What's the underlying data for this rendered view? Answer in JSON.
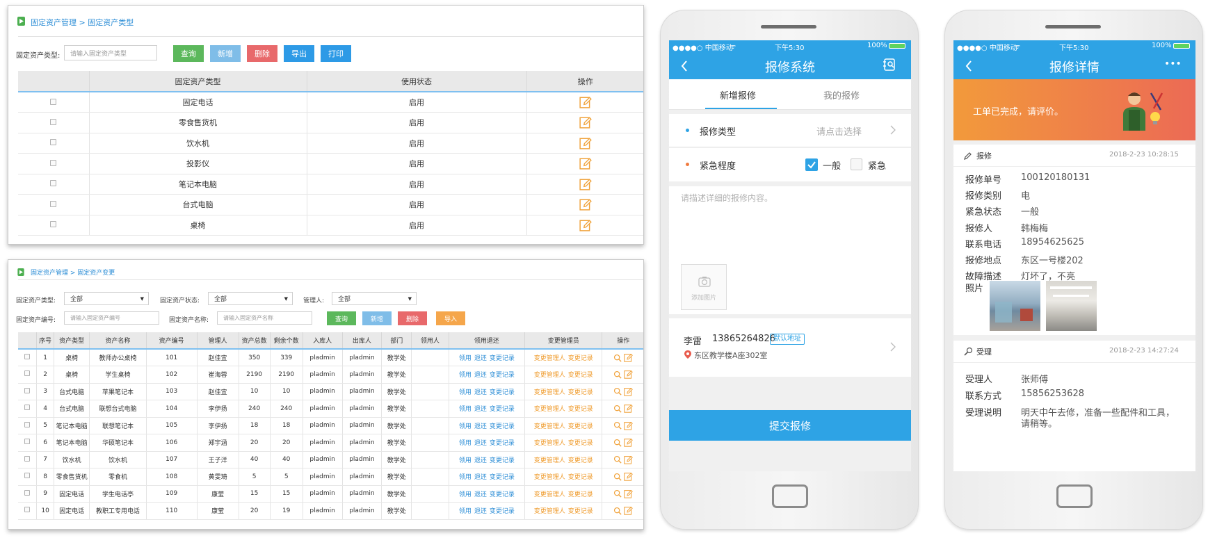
{
  "panel1": {
    "breadcrumb": "固定资产管理 > 固定资产类型",
    "filter_label": "固定资产类型:",
    "filter_placeholder": "请输入固定资产类型",
    "buttons": {
      "query": "查询",
      "add": "新增",
      "delete": "删除",
      "export": "导出",
      "print": "打印"
    },
    "columns": [
      "固定资产类型",
      "使用状态",
      "操作"
    ],
    "rows": [
      {
        "type": "固定电话",
        "status": "启用"
      },
      {
        "type": "零食售货机",
        "status": "启用"
      },
      {
        "type": "饮水机",
        "status": "启用"
      },
      {
        "type": "投影仪",
        "status": "启用"
      },
      {
        "type": "笔记本电脑",
        "status": "启用"
      },
      {
        "type": "台式电脑",
        "status": "启用"
      },
      {
        "type": "桌椅",
        "status": "启用"
      }
    ]
  },
  "panel2": {
    "breadcrumb": "固定资产管理 > 固定资产变更",
    "filters": {
      "type_label": "固定资产类型:",
      "type_value": "全部",
      "state_label": "固定资产状态:",
      "state_value": "全部",
      "manager_label": "管理人:",
      "manager_value": "全部",
      "code_label": "固定资产编号:",
      "code_placeholder": "请输入固定资产编号",
      "name_label": "固定资产名称:",
      "name_placeholder": "请输入固定资产名称"
    },
    "buttons": {
      "query": "查询",
      "add": "新增",
      "delete": "删除",
      "import": "导入"
    },
    "columns": [
      "序号",
      "资产类型",
      "资产名称",
      "资产编号",
      "管理人",
      "资产总数",
      "剩余个数",
      "入库人",
      "出库人",
      "部门",
      "领用人",
      "领用退还",
      "变更管理员",
      "操作"
    ],
    "links": {
      "receive": "领用",
      "return": "退还",
      "change_record": "变更记录",
      "change_manager": "变更管理人"
    },
    "rows": [
      {
        "no": "1",
        "type": "桌椅",
        "name": "教师办公桌椅",
        "code": "101",
        "manager": "赵佳宜",
        "total": "350",
        "remain": "339",
        "in": "pladmin",
        "out": "pladmin",
        "dept": "教学处",
        "user": ""
      },
      {
        "no": "2",
        "type": "桌椅",
        "name": "学生桌椅",
        "code": "102",
        "manager": "崔海蓉",
        "total": "2190",
        "remain": "2190",
        "in": "pladmin",
        "out": "pladmin",
        "dept": "教学处",
        "user": ""
      },
      {
        "no": "3",
        "type": "台式电脑",
        "name": "苹果笔记本",
        "code": "103",
        "manager": "赵佳宜",
        "total": "10",
        "remain": "10",
        "in": "pladmin",
        "out": "pladmin",
        "dept": "教学处",
        "user": ""
      },
      {
        "no": "4",
        "type": "台式电脑",
        "name": "联想台式电脑",
        "code": "104",
        "manager": "李伊扬",
        "total": "240",
        "remain": "240",
        "in": "pladmin",
        "out": "pladmin",
        "dept": "教学处",
        "user": ""
      },
      {
        "no": "5",
        "type": "笔记本电脑",
        "name": "联想笔记本",
        "code": "105",
        "manager": "李伊扬",
        "total": "18",
        "remain": "18",
        "in": "pladmin",
        "out": "pladmin",
        "dept": "教学处",
        "user": ""
      },
      {
        "no": "6",
        "type": "笔记本电脑",
        "name": "华硕笔记本",
        "code": "106",
        "manager": "郑宇涵",
        "total": "20",
        "remain": "20",
        "in": "pladmin",
        "out": "pladmin",
        "dept": "教学处",
        "user": ""
      },
      {
        "no": "7",
        "type": "饮水机",
        "name": "饮水机",
        "code": "107",
        "manager": "王子洋",
        "total": "40",
        "remain": "40",
        "in": "pladmin",
        "out": "pladmin",
        "dept": "教学处",
        "user": ""
      },
      {
        "no": "8",
        "type": "零食售货机",
        "name": "零食机",
        "code": "108",
        "manager": "黄雯琦",
        "total": "5",
        "remain": "5",
        "in": "pladmin",
        "out": "pladmin",
        "dept": "教学处",
        "user": ""
      },
      {
        "no": "9",
        "type": "固定电话",
        "name": "学生电话亭",
        "code": "109",
        "manager": "康莹",
        "total": "15",
        "remain": "15",
        "in": "pladmin",
        "out": "pladmin",
        "dept": "教学处",
        "user": ""
      },
      {
        "no": "10",
        "type": "固定电话",
        "name": "教职工专用电话",
        "code": "110",
        "manager": "康莹",
        "total": "20",
        "remain": "19",
        "in": "pladmin",
        "out": "pladmin",
        "dept": "教学处",
        "user": ""
      }
    ]
  },
  "phone1": {
    "status": {
      "carrier": "●●●●○ 中国移动",
      "time": "下午5:30",
      "battery": "100%"
    },
    "title": "报修系统",
    "tabs": [
      "新增报修",
      "我的报修"
    ],
    "repair_type_label": "报修类型",
    "repair_type_placeholder": "请点击选择",
    "urgency_label": "紧急程度",
    "urgency_options": [
      "一般",
      "紧急"
    ],
    "description_placeholder": "请描述详细的报修内容。",
    "add_photo": "添加图片",
    "contact_name": "李雷",
    "contact_phone": "13865264826",
    "default_badge": "默认地址",
    "address": "东区教学楼A座302室",
    "submit": "提交报修"
  },
  "phone2": {
    "status": {
      "carrier": "●●●●○ 中国移动",
      "time": "下午5:30",
      "battery": "100%"
    },
    "title": "报修详情",
    "more": "•••",
    "banner_text": "工单已完成，请评价。",
    "report_section": {
      "title": "报修",
      "time": "2018-2-23 10:28:15"
    },
    "report_fields": [
      {
        "label": "报修单号",
        "value": "100120180131"
      },
      {
        "label": "报修类别",
        "value": "电"
      },
      {
        "label": "紧急状态",
        "value": "一般"
      },
      {
        "label": "报修人",
        "value": "韩梅梅"
      },
      {
        "label": "联系电话",
        "value": "18954625625"
      },
      {
        "label": "报修地点",
        "value": "东区一号楼202"
      },
      {
        "label": "故障描述",
        "value": "灯坏了，不亮"
      }
    ],
    "photos_label": "照片",
    "accept_section": {
      "title": "受理",
      "time": "2018-2-23 14:27:24"
    },
    "accept_fields": [
      {
        "label": "受理人",
        "value": "张师傅"
      },
      {
        "label": "联系方式",
        "value": "15856253628"
      },
      {
        "label": "受理说明",
        "value": "明天中午去修，准备一些配件和工具，"
      }
    ],
    "accept_note_cont": "请稍等。"
  }
}
